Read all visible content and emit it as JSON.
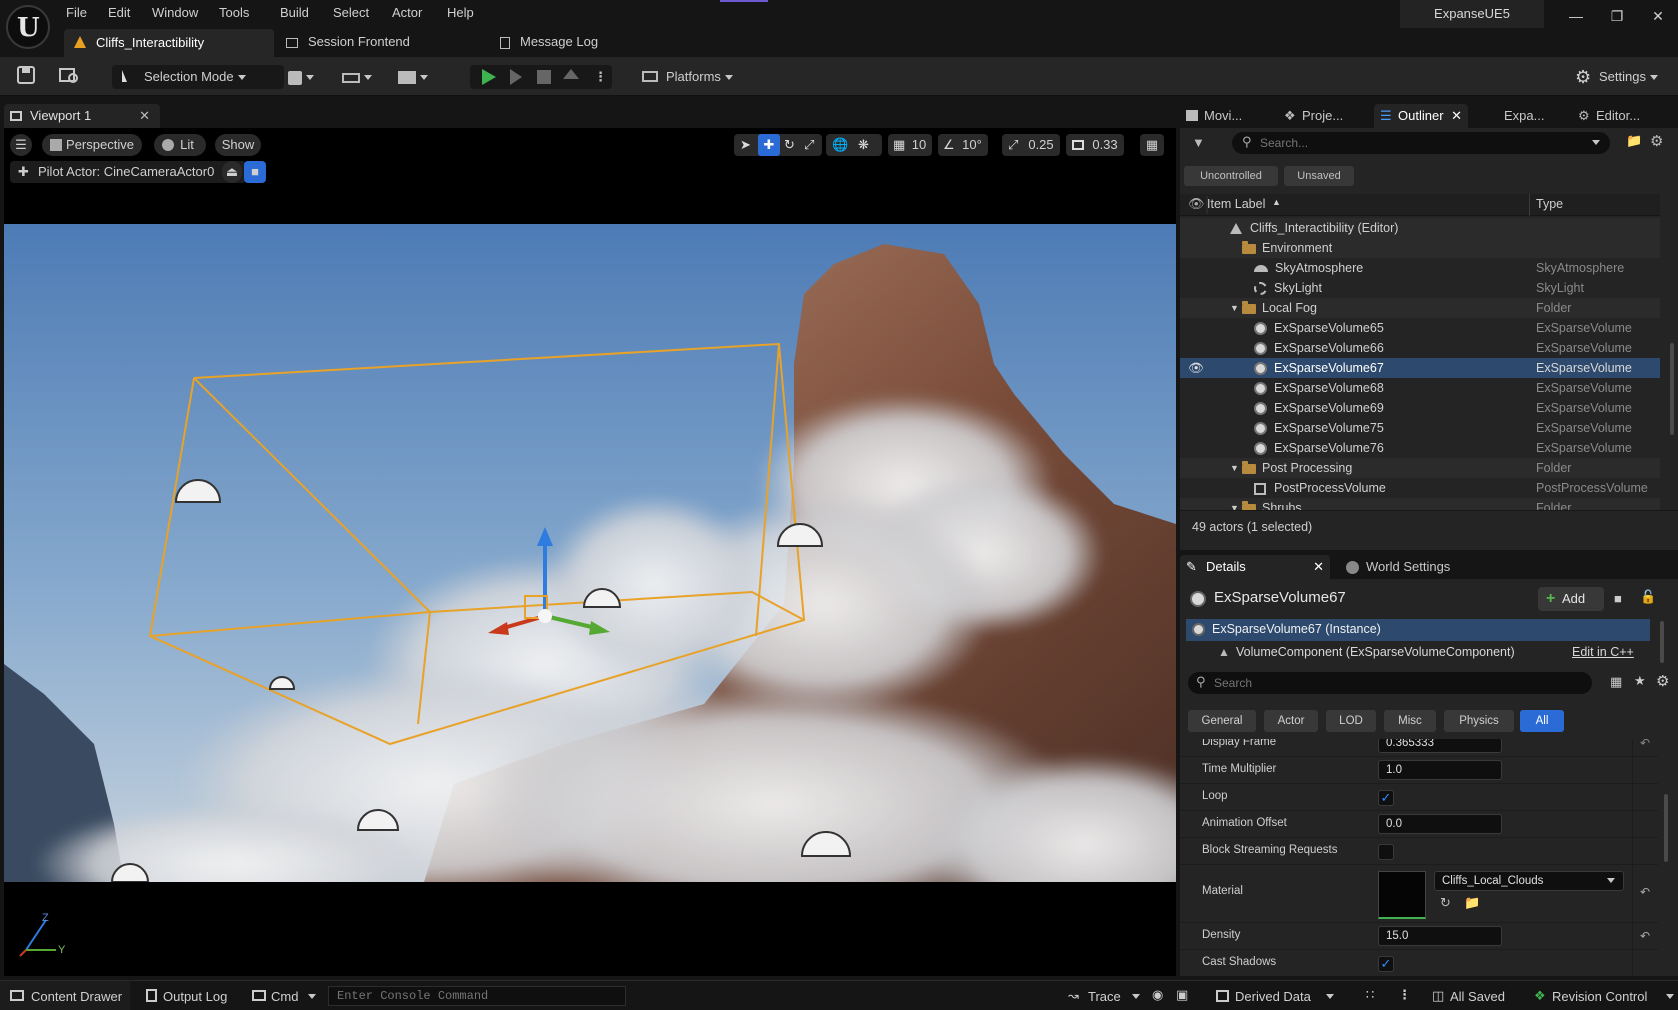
{
  "menu": [
    "File",
    "Edit",
    "Window",
    "Tools",
    "Build",
    "Select",
    "Actor",
    "Help"
  ],
  "project_name": "ExpanseUE5",
  "doc_tabs": [
    "Cliffs_Interactibility",
    "Session Frontend",
    "Message Log"
  ],
  "toolbar": {
    "selection_mode": "Selection Mode",
    "platforms": "Platforms",
    "settings": "Settings"
  },
  "viewport": {
    "tab_label": "Viewport 1",
    "perspective": "Perspective",
    "lit": "Lit",
    "show": "Show",
    "pilot": "Pilot Actor: CineCameraActor0",
    "grid": "10",
    "angle": "10°",
    "scale": "0.25",
    "camera_speed": "0.33",
    "axis": {
      "z": "Z",
      "y": "Y"
    }
  },
  "right_tabs": [
    "Movi...",
    "Proje...",
    "Outliner",
    "Expa...",
    "Editor..."
  ],
  "outliner": {
    "search_placeholder": "Search...",
    "filter_uncontrolled": "Uncontrolled",
    "filter_unsaved": "Unsaved",
    "col_label": "Item Label",
    "col_type": "Type",
    "rows": [
      {
        "label": "Cliffs_Interactibility (Editor)",
        "type": "",
        "indent": 0,
        "kind": "level"
      },
      {
        "label": "Environment",
        "type": "",
        "indent": 1,
        "kind": "folder"
      },
      {
        "label": "SkyAtmosphere",
        "type": "SkyAtmosphere",
        "indent": 2,
        "kind": "sky"
      },
      {
        "label": "SkyLight",
        "type": "SkyLight",
        "indent": 2,
        "kind": "light"
      },
      {
        "label": "Local Fog",
        "type": "Folder",
        "indent": 1,
        "kind": "folder"
      },
      {
        "label": "ExSparseVolume65",
        "type": "ExSparseVolume",
        "indent": 2,
        "kind": "vol"
      },
      {
        "label": "ExSparseVolume66",
        "type": "ExSparseVolume",
        "indent": 2,
        "kind": "vol"
      },
      {
        "label": "ExSparseVolume67",
        "type": "ExSparseVolume",
        "indent": 2,
        "kind": "vol",
        "selected": true
      },
      {
        "label": "ExSparseVolume68",
        "type": "ExSparseVolume",
        "indent": 2,
        "kind": "vol"
      },
      {
        "label": "ExSparseVolume69",
        "type": "ExSparseVolume",
        "indent": 2,
        "kind": "vol"
      },
      {
        "label": "ExSparseVolume75",
        "type": "ExSparseVolume",
        "indent": 2,
        "kind": "vol"
      },
      {
        "label": "ExSparseVolume76",
        "type": "ExSparseVolume",
        "indent": 2,
        "kind": "vol"
      },
      {
        "label": "Post Processing",
        "type": "Folder",
        "indent": 1,
        "kind": "folder"
      },
      {
        "label": "PostProcessVolume",
        "type": "PostProcessVolume",
        "indent": 2,
        "kind": "ppv"
      },
      {
        "label": "Shrubs",
        "type": "Folder",
        "indent": 1,
        "kind": "folder"
      }
    ],
    "actor_count": "49 actors (1 selected)"
  },
  "details": {
    "tab_label": "Details",
    "world_settings": "World Settings",
    "actor_name": "ExSparseVolume67",
    "add_label": "Add",
    "instance": "ExSparseVolume67 (Instance)",
    "component": "VolumeComponent (ExSparseVolumeComponent)",
    "edit_cpp": "Edit in C++",
    "search_placeholder": "Search",
    "filters": [
      "General",
      "Actor",
      "LOD",
      "Misc",
      "Physics",
      "All"
    ],
    "cut_label": "Display Frame",
    "cut_value": "0.365333",
    "time_multiplier_label": "Time Multiplier",
    "time_multiplier": "1.0",
    "loop_label": "Loop",
    "loop": true,
    "animation_offset_label": "Animation Offset",
    "animation_offset": "0.0",
    "block_streaming_label": "Block Streaming Requests",
    "block_streaming": false,
    "material_label": "Material",
    "material": "Cliffs_Local_Clouds",
    "density_label": "Density",
    "density": "15.0",
    "cast_shadows_label": "Cast Shadows",
    "cast_shadows": true
  },
  "statusbar": {
    "content_drawer": "Content Drawer",
    "output_log": "Output Log",
    "cmd": "Cmd",
    "console_placeholder": "Enter Console Command",
    "trace": "Trace",
    "derived_data": "Derived Data",
    "all_saved": "All Saved",
    "revision_control": "Revision Control"
  },
  "colors": {
    "accent": "#2b6bd6",
    "selection_row": "#2d4a6e",
    "play_green": "#3fb34f",
    "bounds_orange": "#e8a228"
  }
}
